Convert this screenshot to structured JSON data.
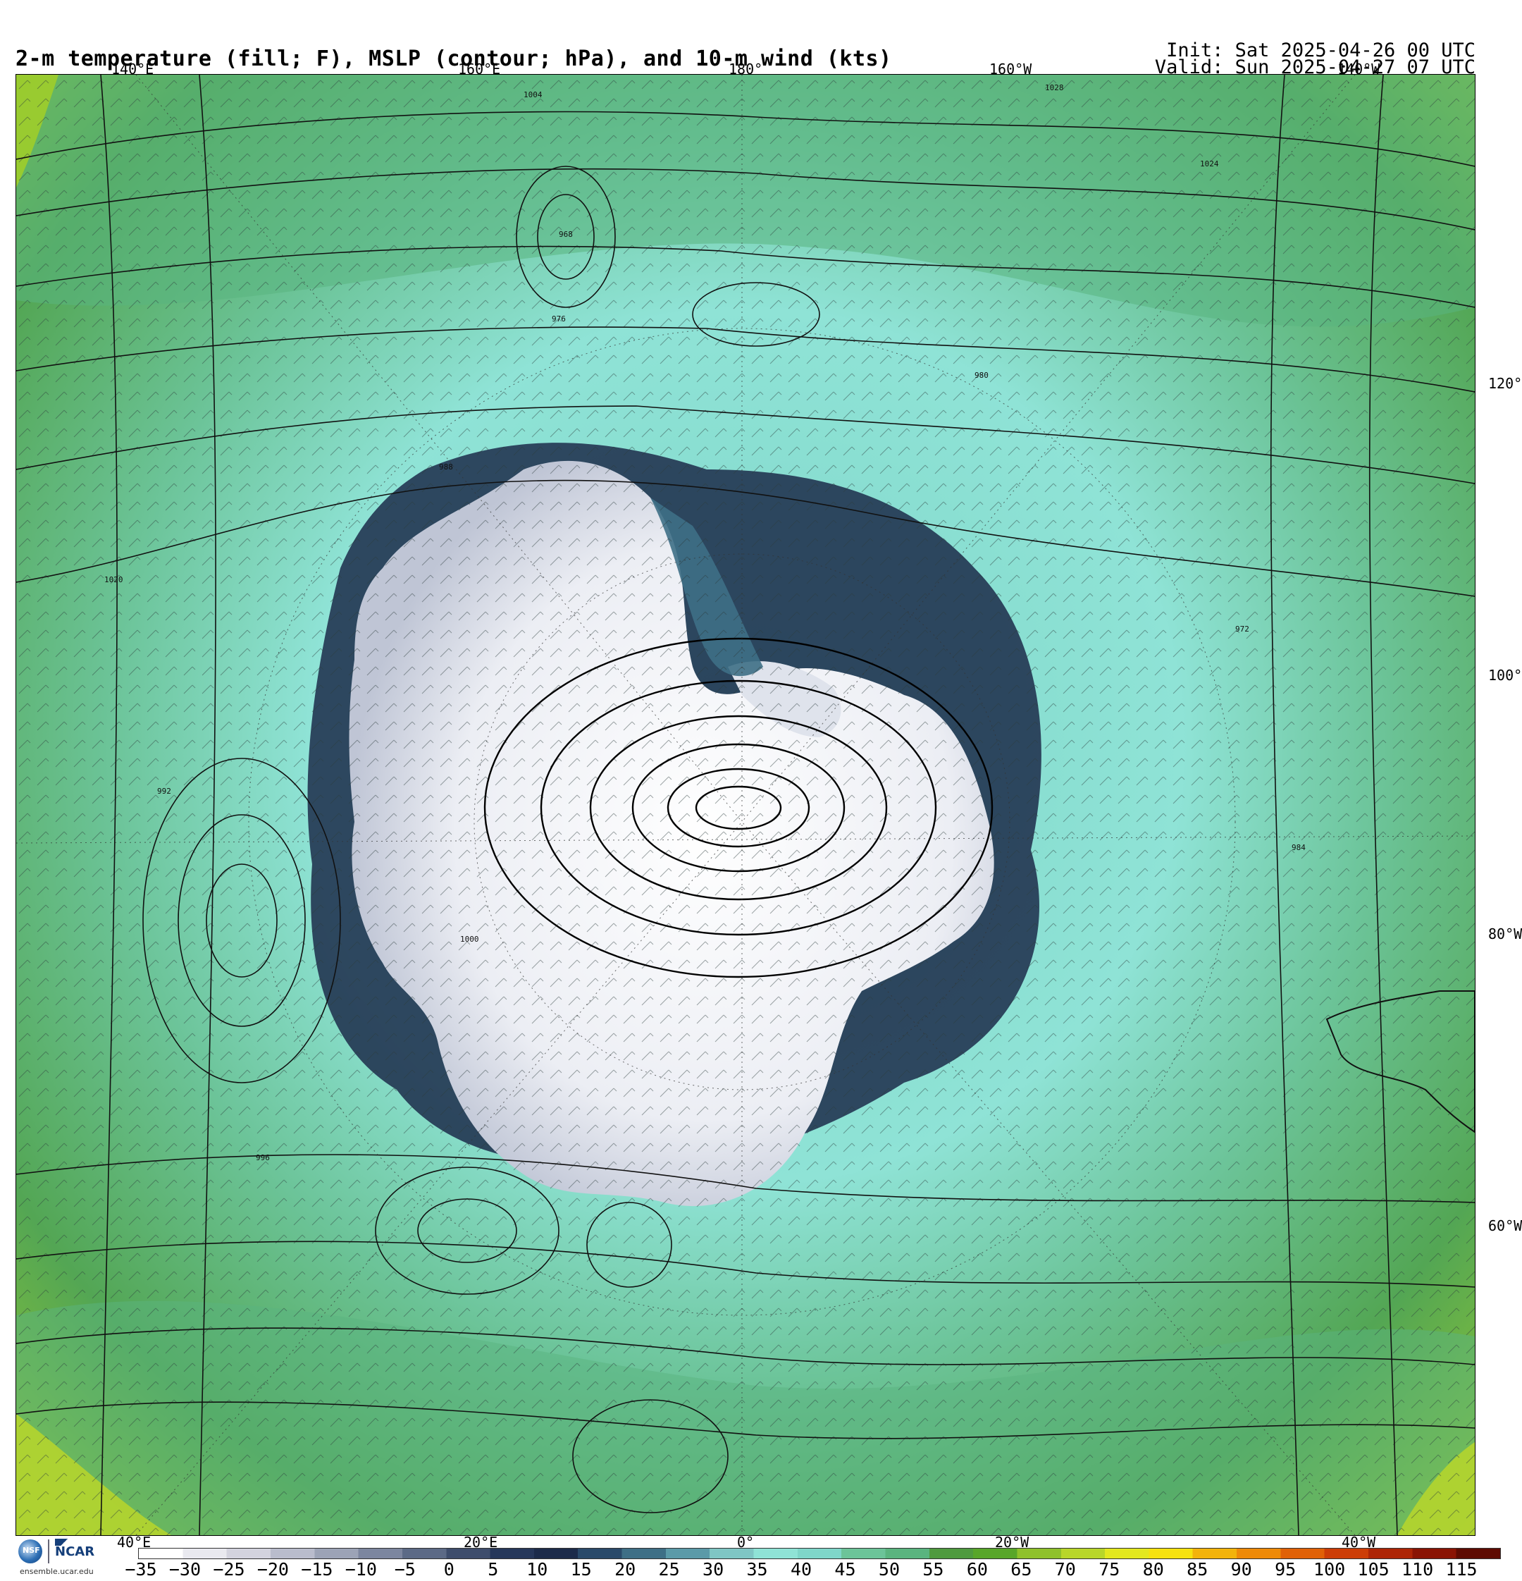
{
  "header": {
    "title": "2-m temperature (fill; F), MSLP (contour; hPa), and 10-m wind (kts)",
    "init": "Init: Sat 2025-04-26 00 UTC",
    "valid": "Valid: Sun 2025-04-27 07 UTC"
  },
  "map": {
    "projection": "south-polar-stereographic",
    "top_lon_labels": [
      "140°E",
      "160°E",
      "180°",
      "160°W",
      "140°W"
    ],
    "bottom_lon_labels": [
      "40°E",
      "20°E",
      "0°",
      "20°W",
      "40°W"
    ],
    "right_lon_labels": [
      "120°W",
      "100°W",
      "80°W",
      "60°W"
    ],
    "pressure_labels": [
      "1004",
      "1028",
      "1024",
      "1020",
      "996",
      "992",
      "988",
      "984",
      "980",
      "976",
      "972",
      "968",
      "1000"
    ],
    "colors": {
      "cold_white": "#f4f4f8",
      "cold_gray": "#9ca3b6",
      "navy": "#1c2b4a",
      "teal": "#7fd6c9",
      "aqua": "#8fe3d6",
      "mint": "#6cc499",
      "green": "#53a654",
      "dark_green": "#4f9a3f",
      "yellow_green": "#b8d62a"
    }
  },
  "colorbar": {
    "ticks": [
      "−35",
      "−30",
      "−25",
      "−20",
      "−15",
      "−10",
      "−5",
      "0",
      "5",
      "10",
      "15",
      "20",
      "25",
      "30",
      "35",
      "40",
      "45",
      "50",
      "55",
      "60",
      "65",
      "70",
      "75",
      "80",
      "85",
      "90",
      "95",
      "100",
      "105",
      "110",
      "115"
    ],
    "colors": [
      "#ffffff",
      "#e9e9ef",
      "#d3d3de",
      "#b9bccc",
      "#9ca3b6",
      "#7c869f",
      "#5c6a86",
      "#3e4d6c",
      "#26375a",
      "#1c2b4a",
      "#2a4a6a",
      "#3e6f86",
      "#5b9aa8",
      "#7fc6c4",
      "#8fe3d6",
      "#7fd6c9",
      "#6cc499",
      "#5ab47f",
      "#4f9a3f",
      "#58a62a",
      "#8fc12b",
      "#b8d62a",
      "#e3e81f",
      "#f6e20f",
      "#f3b30b",
      "#ee8a08",
      "#e06107",
      "#cc3d07",
      "#ad2506",
      "#8a1404",
      "#5e0b02"
    ]
  },
  "logos": {
    "nsf": "NSF",
    "ncar": "NCAR",
    "url": "ensemble.ucar.edu"
  }
}
